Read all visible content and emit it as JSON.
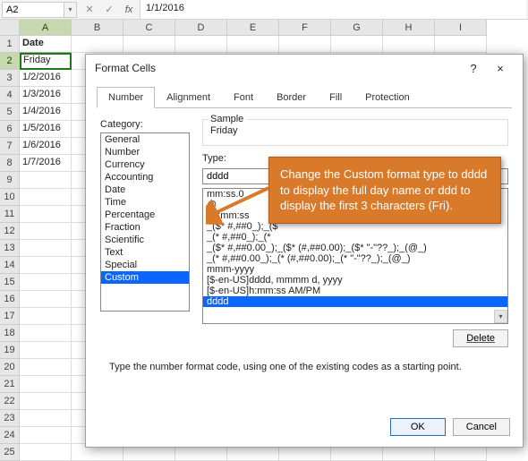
{
  "formula_bar": {
    "name_box": "A2",
    "cancel_icon": "✕",
    "enter_icon": "✓",
    "fx_icon": "fx",
    "formula": "1/1/2016"
  },
  "columns": [
    "A",
    "B",
    "C",
    "D",
    "E",
    "F",
    "G",
    "H",
    "I"
  ],
  "active_col": "A",
  "rows": [
    {
      "n": 1,
      "a": "Date",
      "bold": true
    },
    {
      "n": 2,
      "a": "Friday",
      "active": true
    },
    {
      "n": 3,
      "a": "1/2/2016"
    },
    {
      "n": 4,
      "a": "1/3/2016"
    },
    {
      "n": 5,
      "a": "1/4/2016"
    },
    {
      "n": 6,
      "a": "1/5/2016"
    },
    {
      "n": 7,
      "a": "1/6/2016"
    },
    {
      "n": 8,
      "a": "1/7/2016"
    },
    {
      "n": 9,
      "a": ""
    },
    {
      "n": 10,
      "a": ""
    },
    {
      "n": 11,
      "a": ""
    },
    {
      "n": 12,
      "a": ""
    },
    {
      "n": 13,
      "a": ""
    },
    {
      "n": 14,
      "a": ""
    },
    {
      "n": 15,
      "a": ""
    },
    {
      "n": 16,
      "a": ""
    },
    {
      "n": 17,
      "a": ""
    },
    {
      "n": 18,
      "a": ""
    },
    {
      "n": 19,
      "a": ""
    },
    {
      "n": 20,
      "a": ""
    },
    {
      "n": 21,
      "a": ""
    },
    {
      "n": 22,
      "a": ""
    },
    {
      "n": 23,
      "a": ""
    },
    {
      "n": 24,
      "a": ""
    },
    {
      "n": 25,
      "a": ""
    }
  ],
  "dialog": {
    "title": "Format Cells",
    "help": "?",
    "close": "×",
    "tabs": [
      "Number",
      "Alignment",
      "Font",
      "Border",
      "Fill",
      "Protection"
    ],
    "active_tab": "Number",
    "category_label": "Category:",
    "categories": [
      "General",
      "Number",
      "Currency",
      "Accounting",
      "Date",
      "Time",
      "Percentage",
      "Fraction",
      "Scientific",
      "Text",
      "Special",
      "Custom"
    ],
    "selected_category": "Custom",
    "sample_label": "Sample",
    "sample_value": "Friday",
    "type_label": "Type:",
    "type_value": "dddd",
    "type_list": [
      "mm:ss.0",
      "@",
      "[h]:mm:ss",
      "_($* #,##0_);_($",
      "_(* #,##0_);_(*",
      "_($* #,##0.00_);_($* (#,##0.00);_($* \"-\"??_);_(@_)",
      "_(* #,##0.00_);_(* (#,##0.00);_(* \"-\"??_);_(@_)",
      "mmm-yyyy",
      "[$-en-US]dddd, mmmm d, yyyy",
      "[$-en-US]h:mm:ss AM/PM",
      "dddd"
    ],
    "selected_type": "dddd",
    "delete": "Delete",
    "hint": "Type the number format code, using one of the existing codes as a starting point.",
    "ok": "OK",
    "cancel": "Cancel"
  },
  "callout": "Change the Custom format type to dddd to display the full day name or ddd to display the first 3 characters (Fri)."
}
